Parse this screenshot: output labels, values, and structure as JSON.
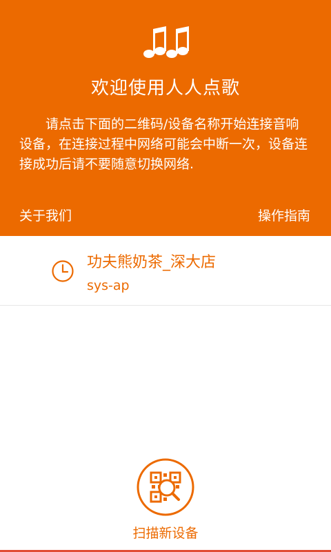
{
  "header": {
    "title": "欢迎使用人人点歌",
    "description": "请点击下面的二维码/设备名称开始连接音响设备，在连接过程中网络可能会中断一次，设备连接成功后请不要随意切换网络.",
    "about_label": "关于我们",
    "guide_label": "操作指南",
    "icon": "music-notes-icon"
  },
  "devices": [
    {
      "name": "功夫熊奶茶_深大店",
      "ssid": "sys-ap",
      "icon": "clock-icon"
    }
  ],
  "scan": {
    "label": "扫描新设备",
    "icon": "qr-scan-icon"
  },
  "colors": {
    "accent": "#ec6a00",
    "background": "#ffffff",
    "divider": "#e6e6e6",
    "bottom_bar": "#e14b35"
  }
}
